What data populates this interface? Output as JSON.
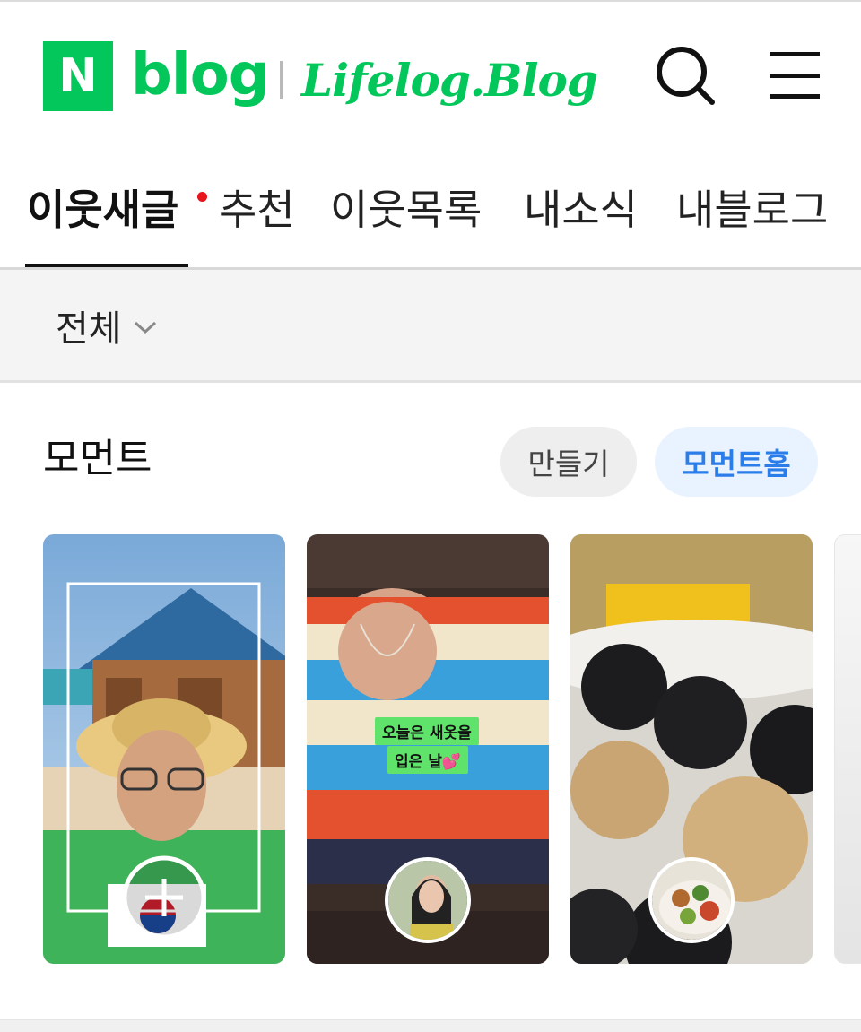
{
  "header": {
    "logo_letter": "N",
    "logo_word": "blog",
    "blog_name": "Lifelog.Blog",
    "search_icon": "search-icon",
    "menu_icon": "hamburger-menu-icon",
    "brand_color": "#03c75a"
  },
  "tabs": [
    {
      "label": "이웃새글",
      "active": true,
      "has_new_dot": true
    },
    {
      "label": "추천",
      "active": false
    },
    {
      "label": "이웃목록",
      "active": false
    },
    {
      "label": "내소식",
      "active": false
    },
    {
      "label": "내블로그",
      "active": false
    }
  ],
  "filter": {
    "label": "전체",
    "icon": "chevron-down-icon"
  },
  "moment": {
    "title": "모먼트",
    "make_button": "만들기",
    "home_button": "모먼트홈",
    "cards": [
      {
        "type": "create",
        "icon": "plus-icon"
      },
      {
        "type": "moment",
        "sticker_lines": [
          "오늘은 새옷을",
          "입은 날💕"
        ]
      },
      {
        "type": "moment"
      },
      {
        "type": "moment-partial"
      }
    ]
  },
  "colors": {
    "accent_blue": "#2b7de9",
    "new_dot": "#e8141c"
  }
}
